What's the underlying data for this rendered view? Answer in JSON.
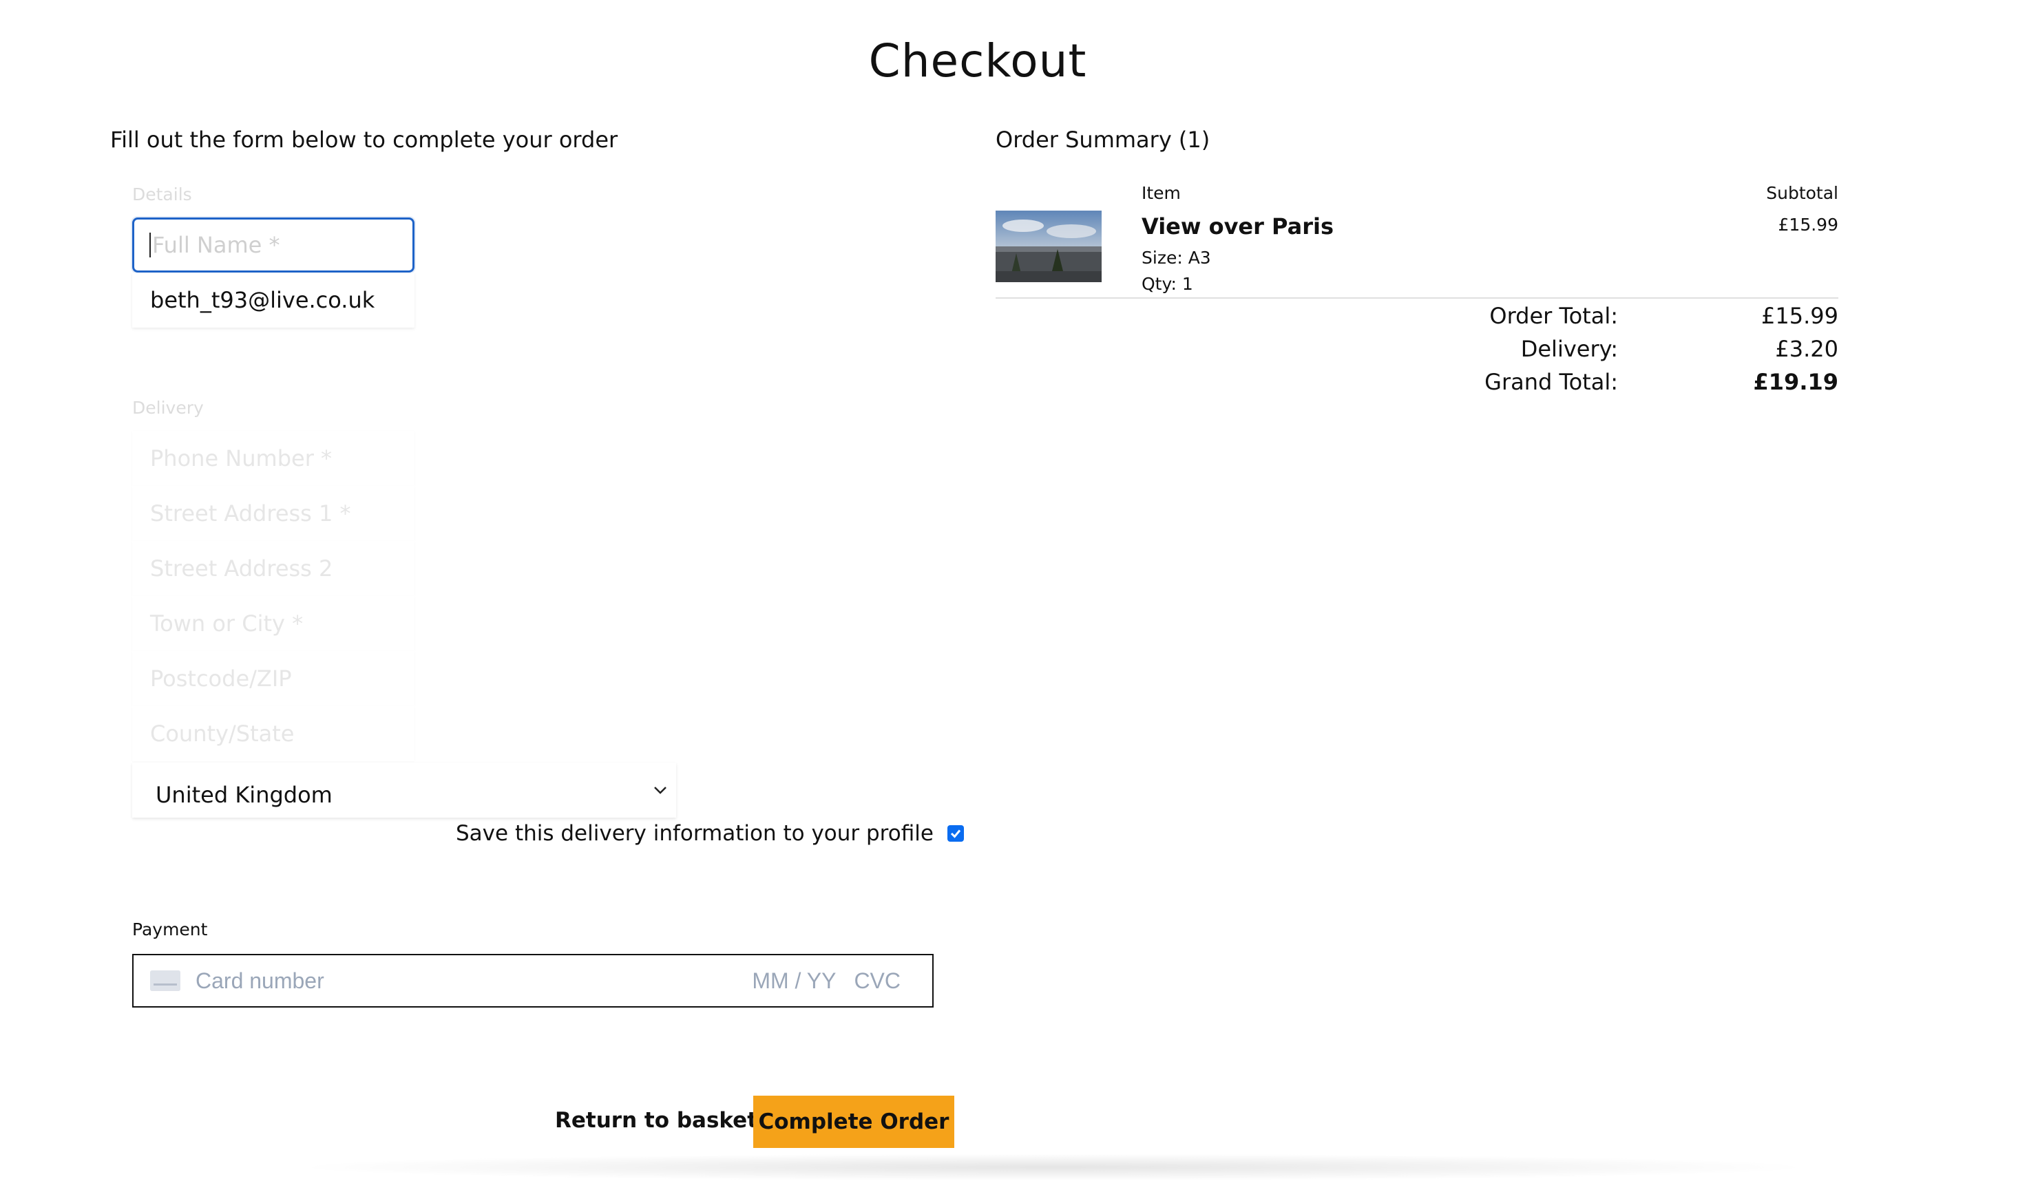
{
  "page": {
    "title": "Checkout",
    "intro": "Fill out the form below to complete your order"
  },
  "form": {
    "details_legend": "Details",
    "full_name_placeholder": "Full Name *",
    "email_value": "beth_t93@live.co.uk",
    "delivery_legend": "Delivery",
    "phone_placeholder": "Phone Number *",
    "street1_placeholder": "Street Address 1 *",
    "street2_placeholder": "Street Address 2",
    "town_placeholder": "Town or City *",
    "postcode_placeholder": "Postcode/ZIP",
    "county_placeholder": "County/State",
    "country_value": "United Kingdom",
    "save_label": "Save this delivery information to your profile",
    "save_checked": true
  },
  "payment": {
    "label": "Payment",
    "card_number_placeholder": "Card number",
    "exp_placeholder": "MM / YY",
    "cvc_placeholder": "CVC"
  },
  "actions": {
    "return_label": "Return to basket",
    "complete_label": "Complete Order"
  },
  "summary": {
    "title": "Order Summary (1)",
    "col_item": "Item",
    "col_subtotal": "Subtotal",
    "item": {
      "name": "View over Paris",
      "size": "Size: A3",
      "qty": "Qty: 1",
      "price": "£15.99"
    },
    "order_total_label": "Order Total:",
    "order_total_value": "£15.99",
    "delivery_label": "Delivery:",
    "delivery_value": "£3.20",
    "grand_total_label": "Grand Total:",
    "grand_total_value": "£19.19"
  },
  "colors": {
    "accent": "#f5a219",
    "focus": "#1e63c8",
    "checkbox": "#0a6cf0"
  }
}
